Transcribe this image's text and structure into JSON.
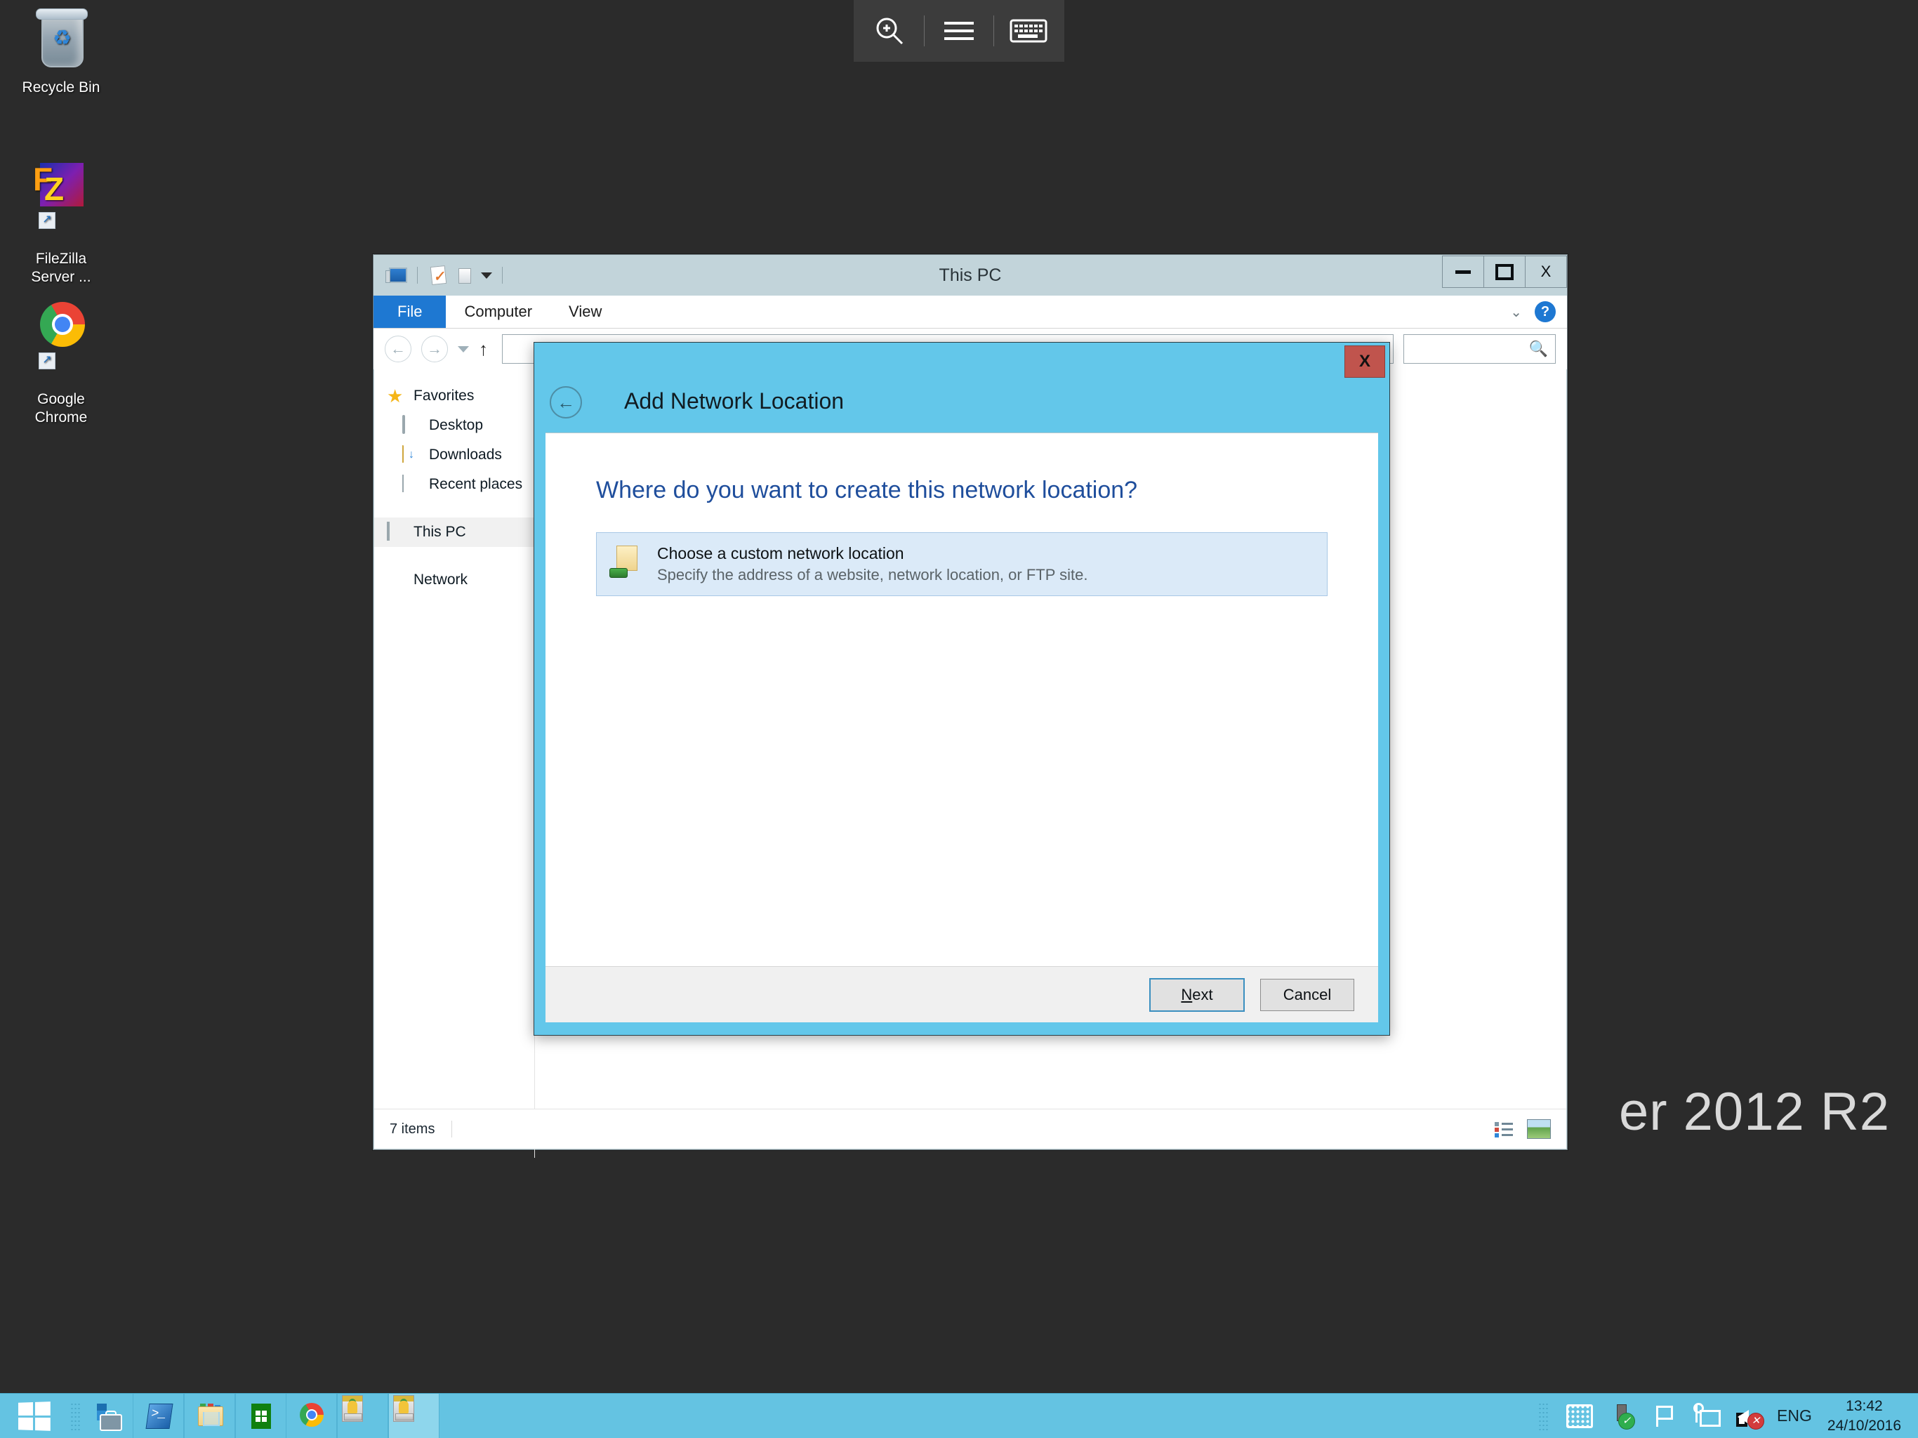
{
  "desktop": {
    "wallpaper_text": "er 2012 R2",
    "background_color": "#2b2b2b",
    "icons": [
      {
        "name": "recycle-bin",
        "label": "Recycle Bin"
      },
      {
        "name": "filezilla-server",
        "label": "FileZilla\nServer ..."
      },
      {
        "name": "google-chrome",
        "label": "Google\nChrome"
      }
    ]
  },
  "top_toolbar": {
    "buttons": [
      {
        "name": "zoom-in-icon",
        "tooltip": "Zoom"
      },
      {
        "name": "menu-icon",
        "tooltip": "Menu"
      },
      {
        "name": "keyboard-icon",
        "tooltip": "Keyboard"
      }
    ]
  },
  "explorer": {
    "title": "This PC",
    "quick_access_toolbar": [
      {
        "name": "this-pc-icon"
      },
      {
        "name": "properties-icon"
      },
      {
        "name": "open-folder-icon"
      },
      {
        "name": "customize-qat-chevron-icon"
      }
    ],
    "caption_buttons": {
      "minimize": "–",
      "maximize": "□",
      "close": "X"
    },
    "ribbon_tabs": [
      {
        "label": "File",
        "selected": true
      },
      {
        "label": "Computer",
        "selected": false
      },
      {
        "label": "View",
        "selected": false
      }
    ],
    "ribbon_help_label": "?",
    "address_bar": {
      "value": "",
      "placeholder": ""
    },
    "search_box": {
      "value": "",
      "placeholder": ""
    },
    "nav_pane": [
      {
        "label": "Favorites",
        "icon": "star-icon",
        "level": 0,
        "selected": false
      },
      {
        "label": "Desktop",
        "icon": "desktop-icon",
        "level": 1,
        "selected": false
      },
      {
        "label": "Downloads",
        "icon": "downloads-folder-icon",
        "level": 1,
        "selected": false
      },
      {
        "label": "Recent places",
        "icon": "recent-places-icon",
        "level": 1,
        "selected": false
      },
      {
        "label": "This PC",
        "icon": "this-pc-icon",
        "level": 0,
        "selected": true
      },
      {
        "label": "Network",
        "icon": "network-icon",
        "level": 0,
        "selected": false
      }
    ],
    "status_bar": {
      "item_count": "7 items",
      "view_buttons": [
        {
          "name": "details-view-button"
        },
        {
          "name": "large-icons-view-button"
        }
      ]
    }
  },
  "dialog": {
    "title": "Add Network Location",
    "back_button": "←",
    "close_button": "X",
    "heading": "Where do you want to create this network location?",
    "options": [
      {
        "title": "Choose a custom network location",
        "subtitle": "Specify the address of a website, network location, or FTP site.",
        "icon": "network-folder-icon",
        "selected": true
      }
    ],
    "buttons": {
      "next_prefix": "",
      "next_accel": "N",
      "next_suffix": "ext",
      "cancel": "Cancel"
    },
    "accent_color": "#63c7ea"
  },
  "taskbar": {
    "start_button": "start-button",
    "apps": [
      {
        "name": "server-manager",
        "active": false
      },
      {
        "name": "powershell",
        "active": false
      },
      {
        "name": "file-explorer",
        "active": false
      },
      {
        "name": "store",
        "active": false
      },
      {
        "name": "google-chrome",
        "active": false
      },
      {
        "name": "filezilla-server-1",
        "active": false
      },
      {
        "name": "filezilla-server-2",
        "active": true
      }
    ],
    "tray": {
      "icons": [
        {
          "name": "touch-keyboard-icon"
        },
        {
          "name": "safely-remove-hardware-icon"
        },
        {
          "name": "action-center-flag-icon"
        },
        {
          "name": "network-icon"
        },
        {
          "name": "volume-muted-icon"
        }
      ],
      "language": "ENG",
      "time": "13:42",
      "date": "24/10/2016"
    },
    "background_color": "#64c3e2"
  }
}
